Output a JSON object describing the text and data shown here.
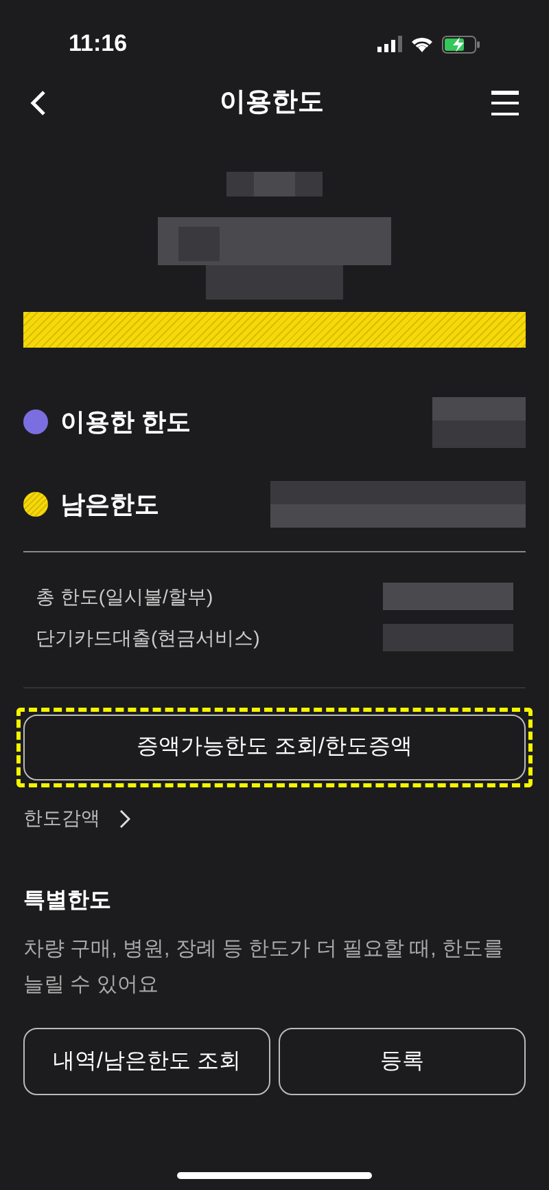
{
  "status_bar": {
    "time": "11:16"
  },
  "header": {
    "title": "이용한도"
  },
  "usage_bar": {
    "level": 1
  },
  "legend": [
    {
      "label": "이용한 한도",
      "color": "#7b6ee0",
      "kind": "solid"
    },
    {
      "label": "남은한도",
      "color": "#f5d90a",
      "kind": "striped"
    }
  ],
  "details": [
    {
      "label": "총 한도(일시불/할부)"
    },
    {
      "label": "단기카드대출(현금서비스)"
    }
  ],
  "increase_button": {
    "label": "증액가능한도 조회/한도증액",
    "highlighted": true
  },
  "decrease_link": {
    "label": "한도감액"
  },
  "special_limit": {
    "title": "특별한도",
    "description": "차량 구매, 병원, 장례 등 한도가 더 필요할 때, 한도를 늘릴 수 있어요",
    "buttons": [
      "내역/남은한도 조회",
      "등록"
    ]
  }
}
